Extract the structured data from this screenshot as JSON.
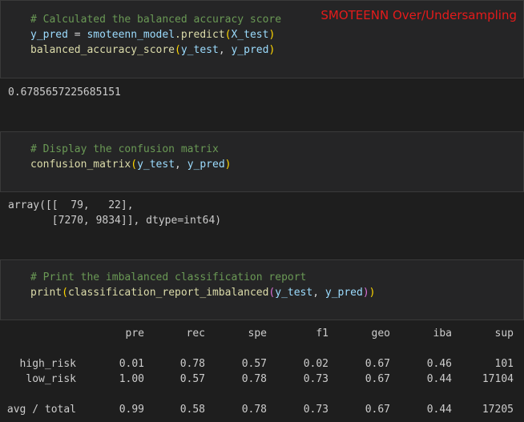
{
  "badge": "SMOTEENN Over/Undersampling",
  "cell1": {
    "comment": "# Calculated the balanced accuracy score",
    "line2_var": "y_pred",
    "line2_eq": " = ",
    "line2_obj": "smoteenn_model",
    "line2_fn": ".predict",
    "line2_arg": "X_test",
    "line3_fn": "balanced_accuracy_score",
    "line3_arg1": "y_test",
    "line3_arg2": "y_pred"
  },
  "out1": "0.6785657225685151",
  "cell2": {
    "comment": "# Display the confusion matrix",
    "fn": "confusion_matrix",
    "arg1": "y_test",
    "arg2": "y_pred"
  },
  "out2": {
    "line1": "array([[  79,   22],",
    "line2": "       [7270, 9834]], dtype=int64)"
  },
  "cell3": {
    "comment": "# Print the imbalanced classification report",
    "fn_print": "print",
    "fn_report": "classification_report_imbalanced",
    "arg1": "y_test",
    "arg2": "y_pred"
  },
  "report": {
    "headers": [
      "pre",
      "rec",
      "spe",
      "f1",
      "geo",
      "iba",
      "sup"
    ],
    "rows": [
      {
        "label": "high_risk",
        "values": [
          "0.01",
          "0.78",
          "0.57",
          "0.02",
          "0.67",
          "0.46",
          "101"
        ]
      },
      {
        "label": "low_risk",
        "values": [
          "1.00",
          "0.57",
          "0.78",
          "0.73",
          "0.67",
          "0.44",
          "17104"
        ]
      },
      {
        "label": "avg / total",
        "values": [
          "0.99",
          "0.58",
          "0.78",
          "0.73",
          "0.67",
          "0.44",
          "17205"
        ]
      }
    ]
  },
  "colors": {
    "background": "#1e1e1e",
    "cell": "#252526",
    "comment": "#6a9955",
    "badge": "#e51b1b"
  }
}
